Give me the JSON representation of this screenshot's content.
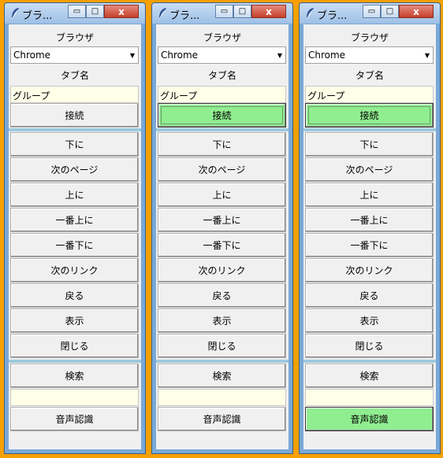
{
  "windows": [
    {
      "title": "ブラ...",
      "browser_label": "ブラウザ",
      "browser_value": "Chrome",
      "tab_label": "タブ名",
      "tab_value": "グループ",
      "connect": "接続",
      "nav": [
        "下に",
        "次のページ",
        "上に",
        "一番上に",
        "一番下に",
        "次のリンク",
        "戻る",
        "表示",
        "閉じる"
      ],
      "search": "検索",
      "search_value": "",
      "voice": "音声認識"
    },
    {
      "title": "ブラ...",
      "browser_label": "ブラウザ",
      "browser_value": "Chrome",
      "tab_label": "タブ名",
      "tab_value": "グループ",
      "connect": "接続",
      "nav": [
        "下に",
        "次のページ",
        "上に",
        "一番上に",
        "一番下に",
        "次のリンク",
        "戻る",
        "表示",
        "閉じる"
      ],
      "search": "検索",
      "search_value": "",
      "voice": "音声認識"
    },
    {
      "title": "ブラ...",
      "browser_label": "ブラウザ",
      "browser_value": "Chrome",
      "tab_label": "タブ名",
      "tab_value": "グループ",
      "connect": "接続",
      "nav": [
        "下に",
        "次のページ",
        "上に",
        "一番上に",
        "一番下に",
        "次のリンク",
        "戻る",
        "表示",
        "閉じる"
      ],
      "search": "検索",
      "search_value": "",
      "voice": "音声認識"
    }
  ],
  "titlebar_buttons": {
    "minimize": "▭",
    "maximize": "□",
    "close": "x"
  },
  "colors": {
    "background": "#f7a000",
    "active_button": "#90ee90",
    "entry_bg": "#ffffe8",
    "separator": "#9dc9de"
  }
}
